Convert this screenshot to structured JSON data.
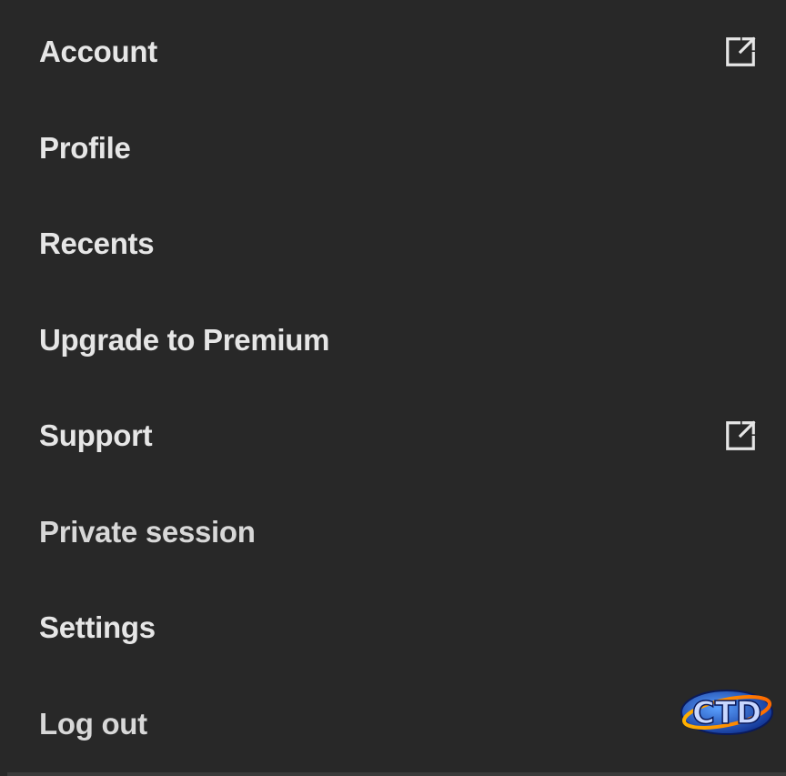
{
  "menu": {
    "items": [
      {
        "label": "Account",
        "external": true
      },
      {
        "label": "Profile",
        "external": false
      },
      {
        "label": "Recents",
        "external": false
      },
      {
        "label": "Upgrade to Premium",
        "external": false
      },
      {
        "label": "Support",
        "external": true
      },
      {
        "label": "Private session",
        "external": false
      },
      {
        "label": "Settings",
        "external": false
      },
      {
        "label": "Log out",
        "external": false
      }
    ],
    "external_icon": "external-link-icon"
  },
  "watermark": {
    "text": "CTD"
  },
  "colors": {
    "background": "#282828",
    "text": "#e6e6e6",
    "icon": "#e6e6e6"
  }
}
